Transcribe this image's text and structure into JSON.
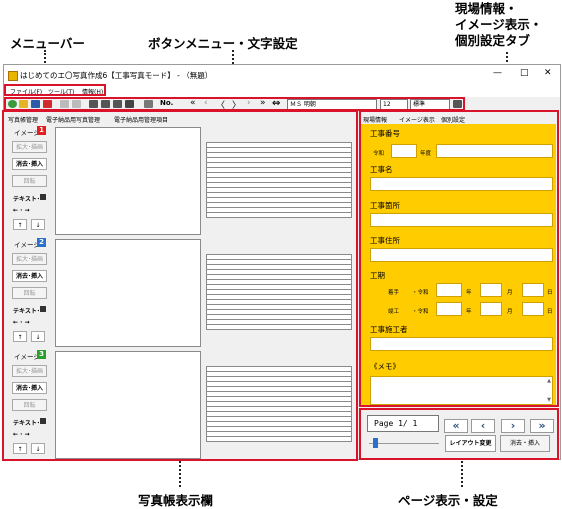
{
  "callouts": {
    "menu_bar": "メニューバー",
    "button_menu": "ボタンメニュー・文字設定",
    "right_tabs": [
      "現場情報・",
      "イメージ表示・",
      "個別設定タブ"
    ],
    "photo_area": "写真帳表示欄",
    "page_settings": "ページ表示・設定"
  },
  "window": {
    "title": "はじめてのエ〇写真作成6【工事写真モード】 - （無題）",
    "controls": {
      "minimize": "—",
      "maximize": "□",
      "close": "✕"
    }
  },
  "menu": [
    "ファイル(F)",
    "ツール(T)",
    "情報(H)"
  ],
  "toolbar": {
    "no_label": "No.",
    "font_value": "ＭＳ 明朝",
    "size_value": "12",
    "style_value": "標準"
  },
  "left_tabs": [
    "写真帳管理",
    "電子納品用写真管理",
    "電子納品用管理項目"
  ],
  "images": [
    {
      "label": "イメージ",
      "num": "1",
      "num_color": "#e02020"
    },
    {
      "label": "イメージ",
      "num": "2",
      "num_color": "#2a72c8"
    },
    {
      "label": "イメージ",
      "num": "3",
      "num_color": "#2aa02a"
    }
  ],
  "image_buttons": {
    "expand": "拡大･描画",
    "erase_insert": "消去･挿入",
    "rotate": "回転",
    "text": "テキスト･",
    "arrows_lr": "← · →",
    "up": "↑",
    "down": "↓"
  },
  "right_tabs": [
    "現場情報",
    "イメージ表示",
    "個別設定"
  ],
  "site_info": {
    "project_no_label": "工事番号",
    "era": "令和",
    "year_label": "年度",
    "project_name_label": "工事名",
    "location_label": "工事箇所",
    "address_label": "工事住所",
    "period_label": "工期",
    "start_label": "着手",
    "finish_label": "竣工",
    "era_prefix": "・令和",
    "year": "年",
    "month": "月",
    "day": "日",
    "contractor_label": "工事施工者",
    "memo_label": "《メモ》"
  },
  "page_nav": {
    "page_text": "Page  1/ 1",
    "first": "«",
    "prev": "‹",
    "next": "›",
    "last": "»",
    "layout_button": "レイアウト変更",
    "erase_insert_button": "消去・挿入",
    "slider_level": 0.05
  },
  "colors": {
    "info_panel": "#ffcc00",
    "highlight": "#d9142a"
  }
}
